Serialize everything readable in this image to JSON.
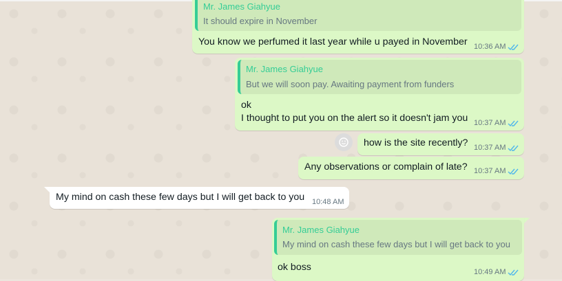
{
  "messages": [
    {
      "direction": "out",
      "quote": {
        "author": "Mr. James Giahyue",
        "text": "It should expire in November"
      },
      "text": "You know we perfumed it last year while u payed in November",
      "time": "10:36 AM",
      "status": "read"
    },
    {
      "direction": "out",
      "quote": {
        "author": "Mr. James Giahyue",
        "text": "But we will soon pay. Awaiting payment from funders"
      },
      "lines": [
        "ok",
        "I thought to put you on the alert so it doesn't jam you"
      ],
      "time": "10:37 AM",
      "status": "read"
    },
    {
      "direction": "out",
      "text": "how is the site recently?",
      "time": "10:37 AM",
      "status": "read",
      "reaction_icon": "smiley-icon"
    },
    {
      "direction": "out",
      "text": "Any observations or complain of late?",
      "time": "10:37 AM",
      "status": "read"
    },
    {
      "direction": "in",
      "text": "My mind on cash these few days but I will get back to you",
      "time": "10:48 AM"
    },
    {
      "direction": "out",
      "quote": {
        "author": "Mr. James Giahyue",
        "text": "My mind on cash these few days but I will get back to you"
      },
      "text": "ok boss",
      "time": "10:49 AM",
      "status": "read"
    }
  ],
  "colors": {
    "outgoing_bubble": "#dcf8c6",
    "incoming_bubble": "#ffffff",
    "quote_author": "#35cd96",
    "read_ticks": "#4fb6ec",
    "wallpaper": "#e9e2d8"
  }
}
